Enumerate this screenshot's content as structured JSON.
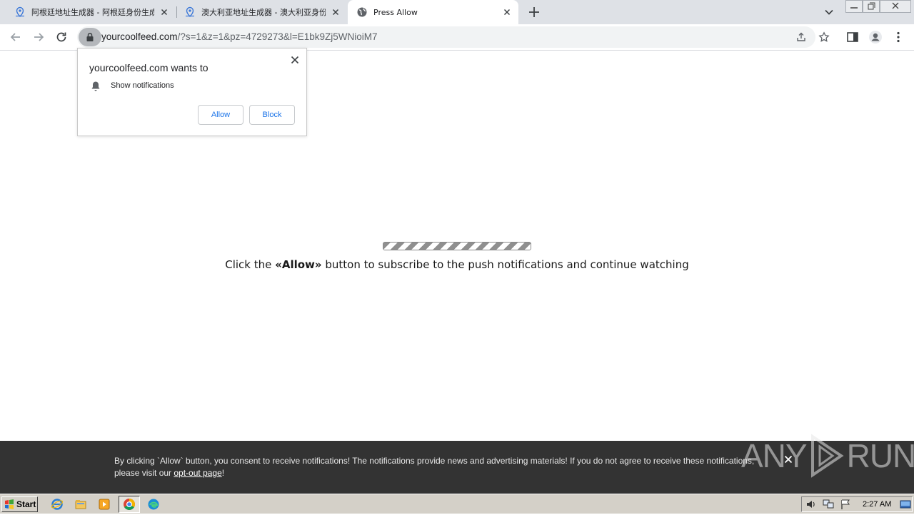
{
  "browser": {
    "tabs": [
      {
        "title": "阿根廷地址生成器 - 阿根廷身份生成"
      },
      {
        "title": "澳大利亚地址生成器 - 澳大利亚身份"
      },
      {
        "title": "Press Allow"
      }
    ],
    "url_host": "yourcoolfeed.com",
    "url_path": "/?s=1&z=1&pz=4729273&l=E1bk9Zj5WNioiM7"
  },
  "permission_popup": {
    "title": "yourcoolfeed.com wants to",
    "permission": "Show notifications",
    "allow_label": "Allow",
    "block_label": "Block"
  },
  "page": {
    "message_prefix": "Click the ",
    "message_bold": "«Allow»",
    "message_suffix": " button to subscribe to the push notifications and continue watching"
  },
  "banner": {
    "text": "By clicking `Allow` button, you consent to receive notifications! The notifications provide news and advertising materials! If you do not agree to receive these notifications, please visit our ",
    "link": "opt-out page",
    "text_end": "!"
  },
  "watermark": {
    "left": "ANY",
    "right": "RUN"
  },
  "taskbar": {
    "start_label": "Start",
    "clock": "2:27 AM"
  }
}
